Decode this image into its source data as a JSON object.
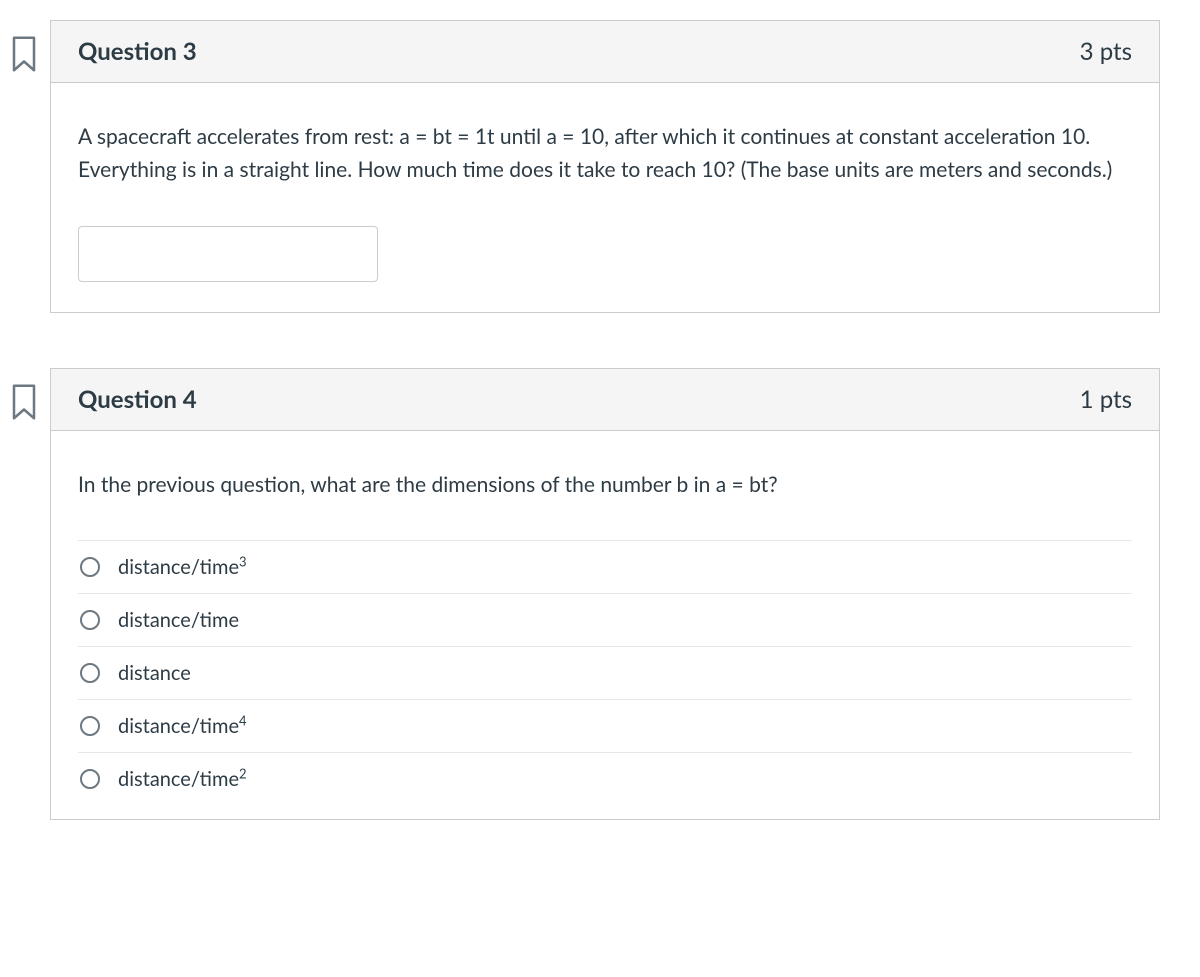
{
  "questions": [
    {
      "title": "Question 3",
      "pts": "3 pts",
      "prompt": "A spacecraft accelerates from rest: a = bt = 1t until a = 10, after which it continues at constant acceleration 10.  Everything is in a straight line.  How much time does it take to reach 10?  (The base units are meters and seconds.)",
      "input_value": ""
    },
    {
      "title": "Question 4",
      "pts": "1 pts",
      "prompt": "In the previous question, what are the dimensions of the number b in a = bt?",
      "options": [
        {
          "label_html": "distance/time<sup>3</sup>"
        },
        {
          "label_html": "distance/time"
        },
        {
          "label_html": "distance"
        },
        {
          "label_html": "distance/time<sup>4</sup>"
        },
        {
          "label_html": "distance/time<sup>2</sup>"
        }
      ]
    }
  ]
}
